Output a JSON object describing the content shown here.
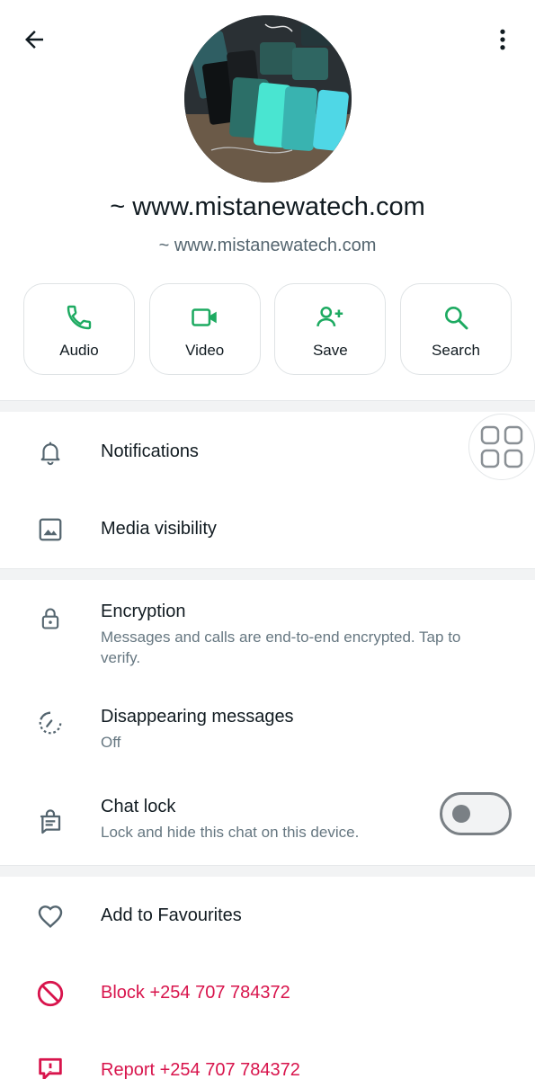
{
  "profile": {
    "name": "~ www.mistanewatech.com",
    "subtitle": "~ www.mistanewatech.com"
  },
  "actions": [
    {
      "label": "Audio",
      "icon": "phone-icon"
    },
    {
      "label": "Video",
      "icon": "video-icon"
    },
    {
      "label": "Save",
      "icon": "add-contact-icon"
    },
    {
      "label": "Search",
      "icon": "search-icon"
    }
  ],
  "settings": {
    "notifications": "Notifications",
    "media_visibility": "Media visibility",
    "encryption": {
      "title": "Encryption",
      "desc": "Messages and calls are end-to-end encrypted. Tap to verify."
    },
    "disappearing": {
      "title": "Disappearing messages",
      "value": "Off"
    },
    "chat_lock": {
      "title": "Chat lock",
      "desc": "Lock and hide this chat on this device.",
      "enabled": false
    }
  },
  "danger": {
    "favourites": "Add to Favourites",
    "block": "Block +254 707 784372",
    "report": "Report +254 707 784372"
  },
  "colors": {
    "accent": "#1daa61",
    "danger": "#d8144c",
    "icon_gray": "#54656f"
  }
}
